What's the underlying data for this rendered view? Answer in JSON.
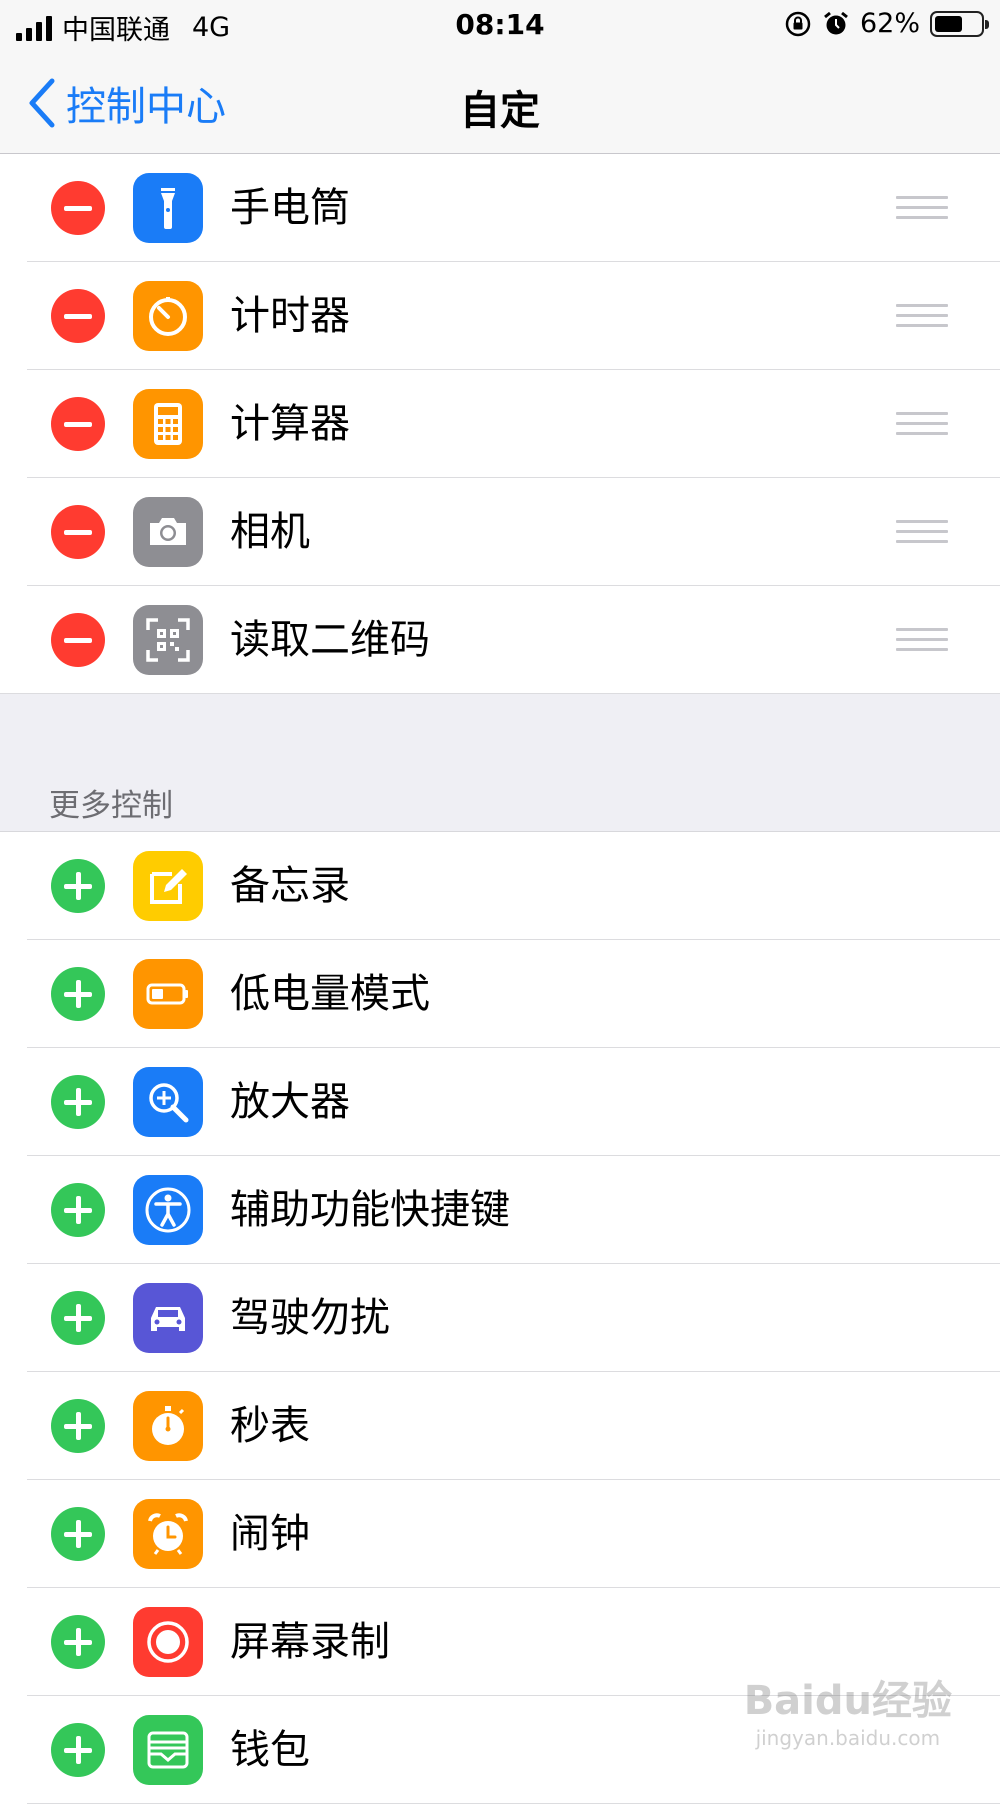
{
  "status_bar": {
    "carrier": "中国联通",
    "network": "4G",
    "time": "08:14",
    "battery_percent": "62%",
    "battery_level": 0.62
  },
  "nav": {
    "back_label": "控制中心",
    "title": "自定"
  },
  "included_controls": [
    {
      "label": "手电筒",
      "icon": "flashlight-icon",
      "color": "#1a7cf7"
    },
    {
      "label": "计时器",
      "icon": "timer-icon",
      "color": "#ff9500"
    },
    {
      "label": "计算器",
      "icon": "calculator-icon",
      "color": "#ff9500"
    },
    {
      "label": "相机",
      "icon": "camera-icon",
      "color": "#8e8e93"
    },
    {
      "label": "读取二维码",
      "icon": "qr-code-icon",
      "color": "#8e8e93"
    }
  ],
  "more_controls_header": "更多控制",
  "more_controls": [
    {
      "label": "备忘录",
      "icon": "notes-icon",
      "color": "#ffcc00"
    },
    {
      "label": "低电量模式",
      "icon": "low-power-icon",
      "color": "#ff9500"
    },
    {
      "label": "放大器",
      "icon": "magnifier-icon",
      "color": "#1a7cf7"
    },
    {
      "label": "辅助功能快捷键",
      "icon": "accessibility-icon",
      "color": "#1a7cf7"
    },
    {
      "label": "驾驶勿扰",
      "icon": "car-icon",
      "color": "#5856d6"
    },
    {
      "label": "秒表",
      "icon": "stopwatch-icon",
      "color": "#ff9500"
    },
    {
      "label": "闹钟",
      "icon": "alarm-icon",
      "color": "#ff9500"
    },
    {
      "label": "屏幕录制",
      "icon": "screen-record-icon",
      "color": "#ff3b30"
    },
    {
      "label": "钱包",
      "icon": "wallet-icon",
      "color": "#34c759"
    }
  ],
  "watermark": {
    "logo": "Baidu经验",
    "url": "jingyan.baidu.com"
  },
  "colors": {
    "accent": "#1a7cf7",
    "remove": "#ff3b30",
    "add": "#34c759"
  }
}
